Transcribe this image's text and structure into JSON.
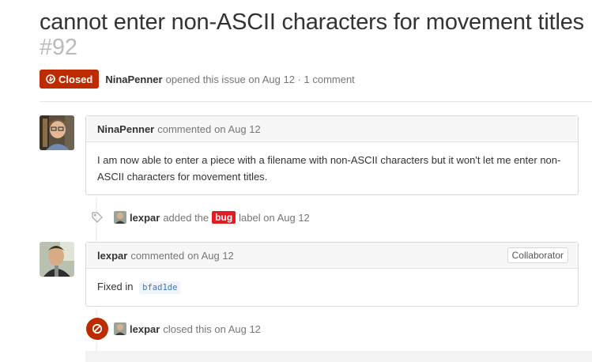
{
  "issue": {
    "title": "cannot enter non-ASCII characters for movement titles",
    "number": "#92",
    "state": "Closed",
    "author": "NinaPenner",
    "meta_text": "opened this issue on Aug 12 · 1 comment"
  },
  "comments": [
    {
      "author": "NinaPenner",
      "action": "commented",
      "date": "on Aug 12",
      "body": "I am now able to enter a piece with a filename with non-ASCII characters but it won't let me enter non-ASCII characters for movement titles."
    },
    {
      "author": "lexpar",
      "action": "commented",
      "date": "on Aug 12",
      "badge": "Collaborator",
      "body_prefix": "Fixed in",
      "commit": "bfad1de"
    }
  ],
  "events": [
    {
      "icon": "tag-icon",
      "actor": "lexpar",
      "text_before": "added the",
      "label": "bug",
      "label_color": "#e11d21",
      "text_after": "label on Aug 12"
    },
    {
      "icon": "closed-icon",
      "actor": "lexpar",
      "text": "closed this on Aug 12"
    }
  ],
  "colors": {
    "closed": "#bd2c00",
    "bug_label": "#e11d21",
    "link": "#4078c0"
  }
}
